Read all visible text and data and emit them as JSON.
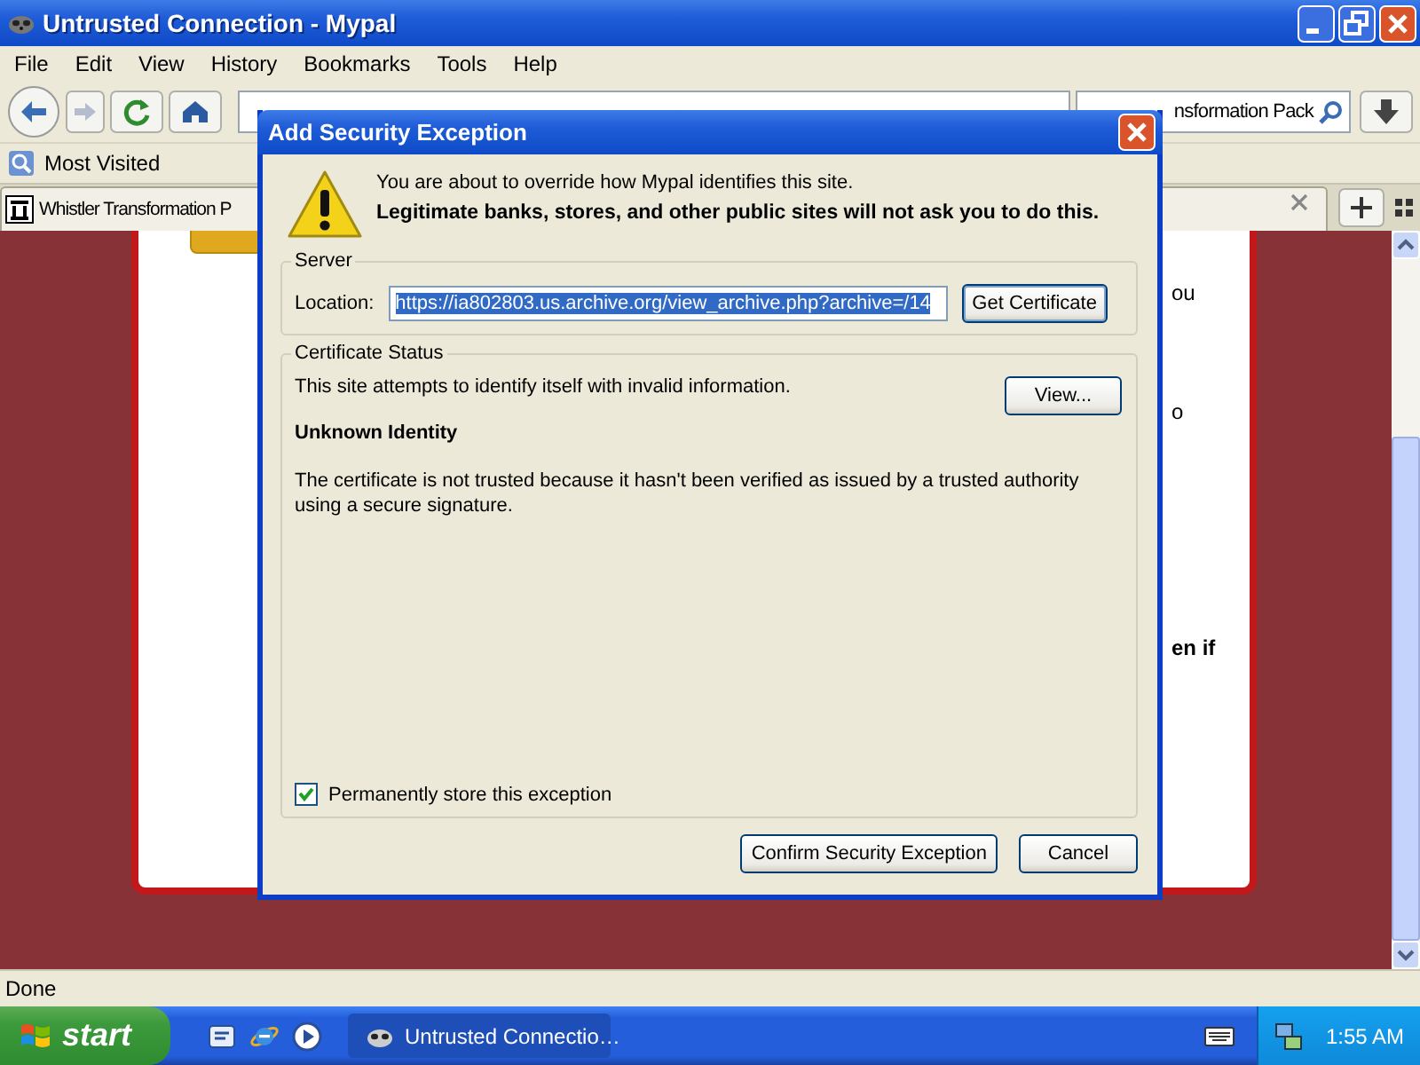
{
  "window": {
    "title": "Untrusted Connection - Mypal"
  },
  "menu": [
    {
      "label": "File"
    },
    {
      "label": "Edit"
    },
    {
      "label": "View"
    },
    {
      "label": "History"
    },
    {
      "label": "Bookmarks"
    },
    {
      "label": "Tools"
    },
    {
      "label": "Help"
    }
  ],
  "search": {
    "value": "nsformation Pack"
  },
  "bookmarks": [
    {
      "label": "Most Visited"
    }
  ],
  "tabs": [
    {
      "label": "Whistler Transformation P",
      "selected": true
    }
  ],
  "page": {
    "fragments": [
      {
        "text": "ou",
        "bold": false
      },
      {
        "text": "o",
        "bold": false
      },
      {
        "text": "en if",
        "bold": true
      }
    ]
  },
  "status_bar": "Done",
  "dialog": {
    "title": "Add Security Exception",
    "intro": "You are about to override how Mypal identifies this site.",
    "warning": "Legitimate banks, stores, and other public sites will not ask you to do this.",
    "server": {
      "legend": "Server",
      "label": "Location:",
      "value": "https://ia802803.us.archive.org/view_archive.php?archive=/14",
      "button": "Get Certificate"
    },
    "status": {
      "legend": "Certificate Status",
      "text": "This site attempts to identify itself with invalid information.",
      "button": "View...",
      "heading": "Unknown Identity",
      "detail": "The certificate is not trusted because it hasn't been verified as issued by a trusted authority using a secure signature."
    },
    "checkbox": {
      "label": "Permanently store this exception",
      "checked": true
    },
    "buttons": [
      "Confirm Security Exception",
      "Cancel"
    ]
  },
  "taskbar": {
    "start": "start",
    "tasks": [
      {
        "label": "Untrusted Connectio…"
      }
    ],
    "clock": "1:55 AM"
  }
}
